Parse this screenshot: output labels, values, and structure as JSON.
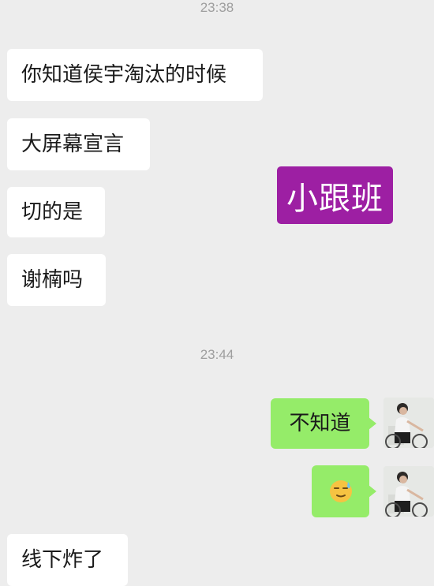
{
  "timestamps": [
    "23:38",
    "23:44"
  ],
  "messages": [
    {
      "side": "left",
      "text": "你知道侯宇淘汰的时候"
    },
    {
      "side": "left",
      "text": "大屏幕宣言"
    },
    {
      "side": "left",
      "text": "切的是"
    },
    {
      "side": "left",
      "text": "谢楠吗"
    },
    {
      "side": "right",
      "text": "不知道"
    },
    {
      "side": "right",
      "emoji": "sweat-smile-emoji"
    },
    {
      "side": "left",
      "text": "线下炸了"
    }
  ],
  "sticker": {
    "text": "小跟班",
    "color": "#9d1fa3"
  },
  "colors": {
    "background": "#ededed",
    "incoming_bubble": "#ffffff",
    "outgoing_bubble": "#95ec69"
  }
}
